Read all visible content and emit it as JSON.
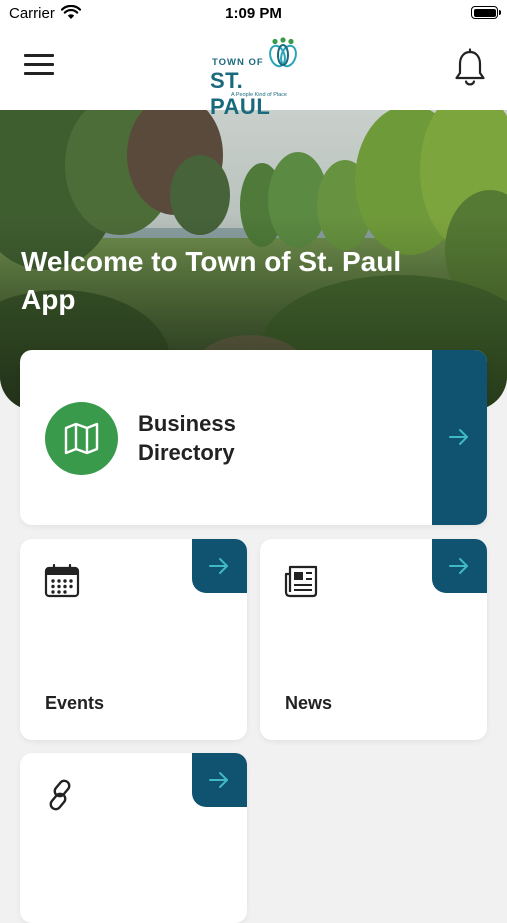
{
  "status": {
    "carrier": "Carrier",
    "time": "1:09 PM"
  },
  "header": {
    "logo": {
      "line1": "TOWN OF",
      "line2": "ST. PAUL",
      "tagline": "A People Kind of Place"
    }
  },
  "hero": {
    "title": "Welcome to Town of St. Paul App"
  },
  "cards": {
    "business": {
      "label": "Business Directory"
    },
    "events": {
      "label": "Events"
    },
    "news": {
      "label": "News"
    },
    "links": {
      "label": ""
    }
  },
  "colors": {
    "accent": "#0f5370",
    "green": "#3a9a4b",
    "brand": "#1a6a7e",
    "arrow": "#3fb8c8"
  },
  "icons": [
    "wifi-icon",
    "battery-icon",
    "menu-icon",
    "bell-icon",
    "map-icon",
    "calendar-icon",
    "newspaper-icon",
    "link-icon",
    "arrow-right-icon"
  ]
}
